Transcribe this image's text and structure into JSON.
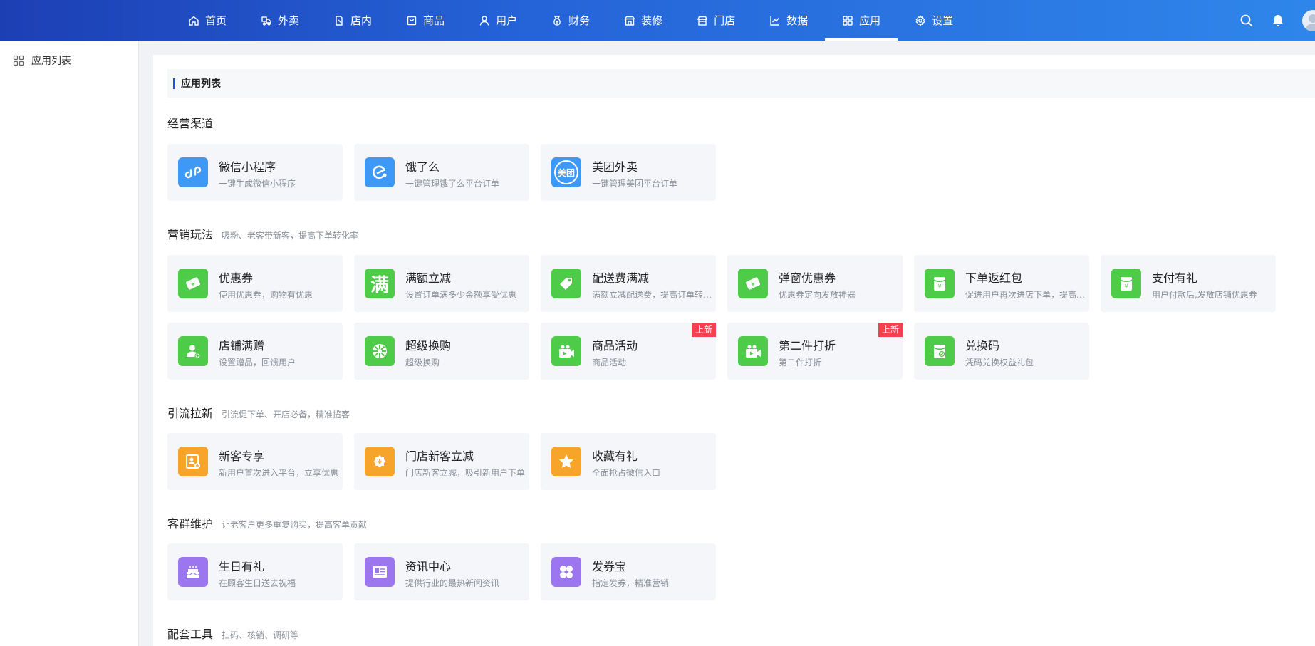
{
  "nav": {
    "items": [
      {
        "label": "首页",
        "icon": "home-icon"
      },
      {
        "label": "外卖",
        "icon": "delivery-icon"
      },
      {
        "label": "店内",
        "icon": "store-inside-icon"
      },
      {
        "label": "商品",
        "icon": "goods-icon"
      },
      {
        "label": "用户",
        "icon": "user-icon"
      },
      {
        "label": "财务",
        "icon": "finance-icon"
      },
      {
        "label": "装修",
        "icon": "decorate-icon"
      },
      {
        "label": "门店",
        "icon": "shop-icon"
      },
      {
        "label": "数据",
        "icon": "chart-icon"
      },
      {
        "label": "应用",
        "icon": "apps-icon",
        "active": true
      },
      {
        "label": "设置",
        "icon": "gear-icon"
      }
    ]
  },
  "sidebar": {
    "items": [
      {
        "label": "应用列表"
      }
    ]
  },
  "page": {
    "section_title": "应用列表"
  },
  "groups": [
    {
      "title": "经营渠道",
      "subtitle": "",
      "cards": [
        {
          "name": "微信小程序",
          "desc": "一键生成微信小程序",
          "color": "#3e98f5",
          "icon": "mini-program-icon"
        },
        {
          "name": "饿了么",
          "desc": "一键管理饿了么平台订单",
          "color": "#3e98f5",
          "icon": "eleme-icon"
        },
        {
          "name": "美团外卖",
          "desc": "一键管理美团平台订单",
          "color": "#3e98f5",
          "icon": "meituan-icon",
          "icon_text": "美团"
        }
      ]
    },
    {
      "title": "营销玩法",
      "subtitle": "吸粉、老客带新客，提高下单转化率",
      "cards": [
        {
          "name": "优惠券",
          "desc": "使用优惠券，购物有优惠",
          "color": "#4fcb4a",
          "icon": "coupon-icon"
        },
        {
          "name": "满额立减",
          "desc": "设置订单满多少金额享受优惠",
          "color": "#4fcb4a",
          "icon": "full-reduce-icon",
          "icon_text": "满"
        },
        {
          "name": "配送费满减",
          "desc": "满额立减配送费，提高订单转化率",
          "color": "#4fcb4a",
          "icon": "delivery-fee-icon"
        },
        {
          "name": "弹窗优惠券",
          "desc": "优惠券定向发放神器",
          "color": "#4fcb4a",
          "icon": "popup-coupon-icon"
        },
        {
          "name": "下单返红包",
          "desc": "促进用户再次进店下单，提高复购",
          "color": "#4fcb4a",
          "icon": "red-packet-icon"
        },
        {
          "name": "支付有礼",
          "desc": "用户付款后,发放店铺优惠券",
          "color": "#4fcb4a",
          "icon": "pay-gift-icon"
        },
        {
          "name": "店铺满赠",
          "desc": "设置赠品，回馈用户",
          "color": "#4fcb4a",
          "icon": "shop-gift-icon"
        },
        {
          "name": "超级换购",
          "desc": "超级换购",
          "color": "#4fcb4a",
          "icon": "super-exchange-icon"
        },
        {
          "name": "商品活动",
          "desc": "商品活动",
          "color": "#4fcb4a",
          "icon": "goods-activity-icon",
          "badge": "上新"
        },
        {
          "name": "第二件打折",
          "desc": "第二件打折",
          "color": "#4fcb4a",
          "icon": "second-discount-icon",
          "badge": "上新"
        },
        {
          "name": "兑换码",
          "desc": "凭码兑换权益礼包",
          "color": "#4fcb4a",
          "icon": "redeem-code-icon"
        }
      ]
    },
    {
      "title": "引流拉新",
      "subtitle": "引流促下单、开店必备，精准揽客",
      "cards": [
        {
          "name": "新客专享",
          "desc": "新用户首次进入平台，立享优惠",
          "color": "#f7a42a",
          "icon": "new-customer-icon"
        },
        {
          "name": "门店新客立减",
          "desc": "门店新客立减，吸引新用户下单",
          "color": "#f7a42a",
          "icon": "store-new-customer-icon"
        },
        {
          "name": "收藏有礼",
          "desc": "全面抢占微信入口",
          "color": "#f7a42a",
          "icon": "star-icon"
        }
      ]
    },
    {
      "title": "客群维护",
      "subtitle": "让老客户更多重复购买，提高客单贡献",
      "cards": [
        {
          "name": "生日有礼",
          "desc": "在顾客生日送去祝福",
          "color": "#9b76ee",
          "icon": "cake-icon"
        },
        {
          "name": "资讯中心",
          "desc": "提供行业的最热新闻资讯",
          "color": "#9b76ee",
          "icon": "news-icon"
        },
        {
          "name": "发券宝",
          "desc": "指定发券，精准营销",
          "color": "#9b76ee",
          "icon": "coupon-box-icon"
        }
      ]
    },
    {
      "title": "配套工具",
      "subtitle": "扫码、核销、调研等",
      "cards": []
    }
  ]
}
